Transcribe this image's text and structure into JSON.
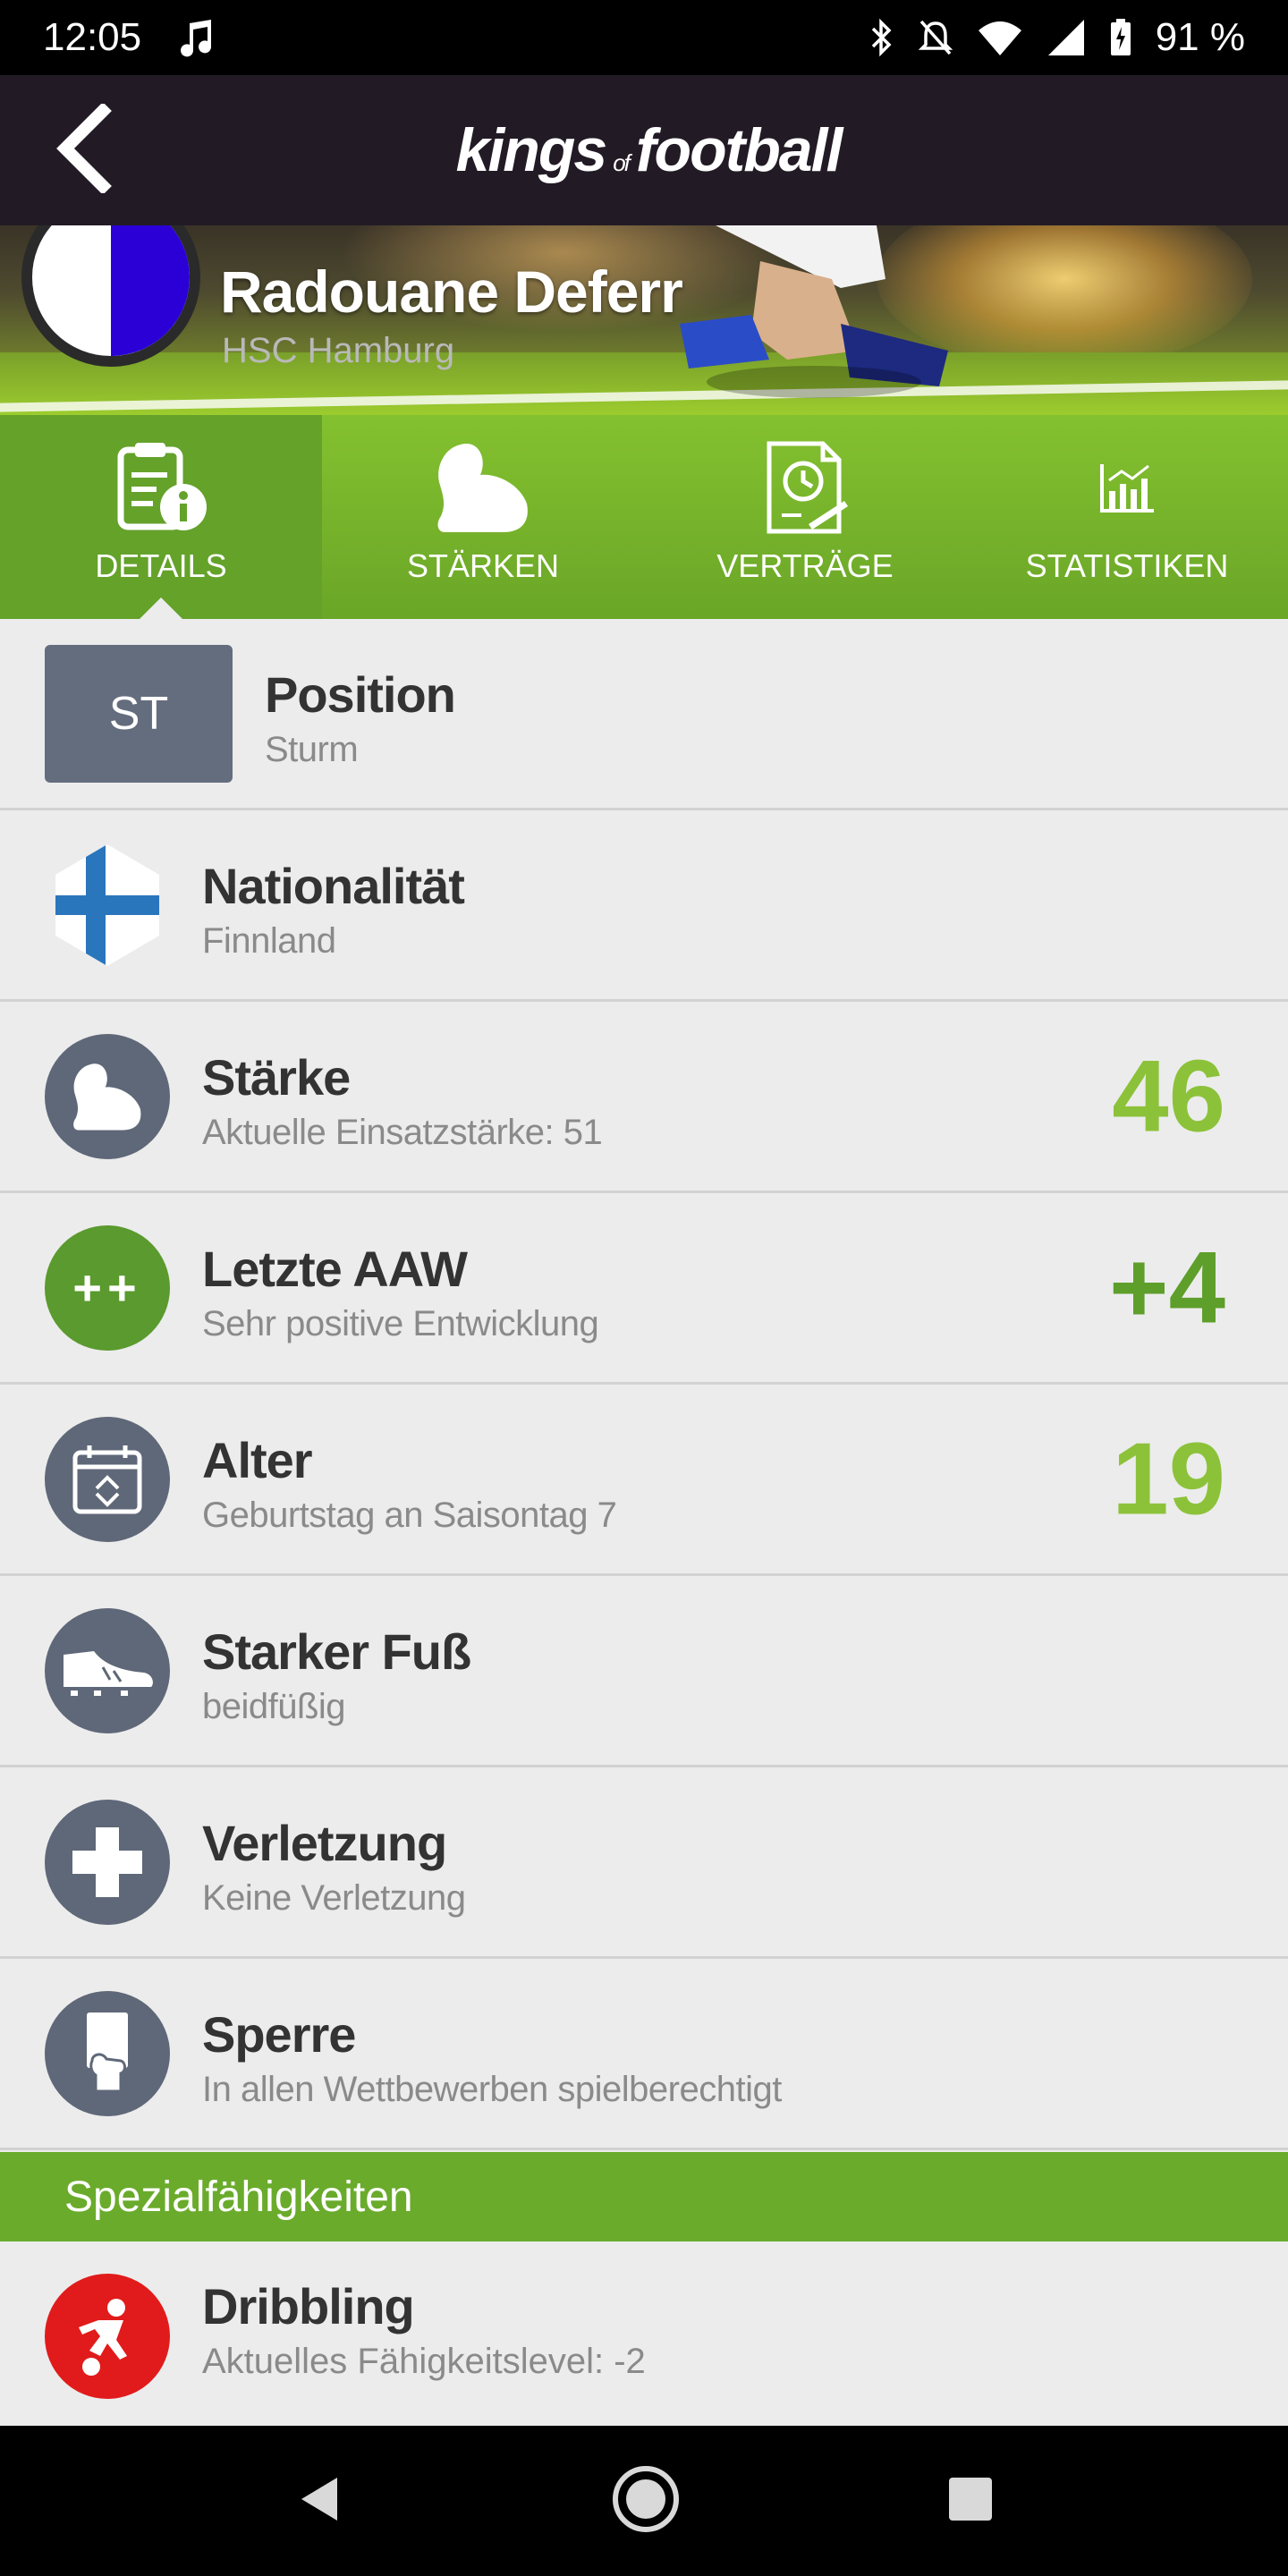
{
  "status_bar": {
    "time": "12:05",
    "battery": "91 %"
  },
  "app": {
    "logo_part1": "kings",
    "logo_of": "of",
    "logo_part2": "football"
  },
  "player": {
    "name": "Radouane Deferr",
    "club": "HSC Hamburg"
  },
  "tabs": [
    {
      "label": "DETAILS",
      "icon": "clipboard-info-icon",
      "active": true
    },
    {
      "label": "STÄRKEN",
      "icon": "flexed-arm-icon",
      "active": false
    },
    {
      "label": "VERTRÄGE",
      "icon": "contract-clock-icon",
      "active": false
    },
    {
      "label": "STATISTIKEN",
      "icon": "bar-chart-icon",
      "active": false
    }
  ],
  "details": {
    "position": {
      "code": "ST",
      "title": "Position",
      "value": "Sturm"
    },
    "nationality": {
      "title": "Nationalität",
      "value": "Finnland",
      "icon": "finland-flag-icon"
    },
    "strength": {
      "title": "Stärke",
      "sub": "Aktuelle Einsatzstärke: 51",
      "value": "46",
      "icon": "flexed-arm-icon"
    },
    "last_aaw": {
      "title": "Letzte AAW",
      "sub": "Sehr positive Entwicklung",
      "value": "+4",
      "badge": "++"
    },
    "age": {
      "title": "Alter",
      "sub": "Geburtstag an Saisontag 7",
      "value": "19",
      "icon": "calendar-icon"
    },
    "foot": {
      "title": "Starker Fuß",
      "sub": "beidfüßig",
      "icon": "football-boot-icon"
    },
    "injury": {
      "title": "Verletzung",
      "sub": "Keine Verletzung",
      "icon": "medical-cross-icon"
    },
    "suspension": {
      "title": "Sperre",
      "sub": "In allen Wettbewerben spielberechtigt",
      "icon": "card-hand-icon"
    }
  },
  "special": {
    "header": "Spezialfähigkeiten",
    "items": [
      {
        "title": "Dribbling",
        "sub": "Aktuelles Fähigkeitslevel: -2",
        "icon": "dribbling-player-icon"
      }
    ]
  },
  "colors": {
    "accent": "#8cc23a",
    "tab_green": "#6aa627",
    "icon_gray": "#5f6878",
    "appbar": "#221b25",
    "danger": "#e11b1b"
  }
}
